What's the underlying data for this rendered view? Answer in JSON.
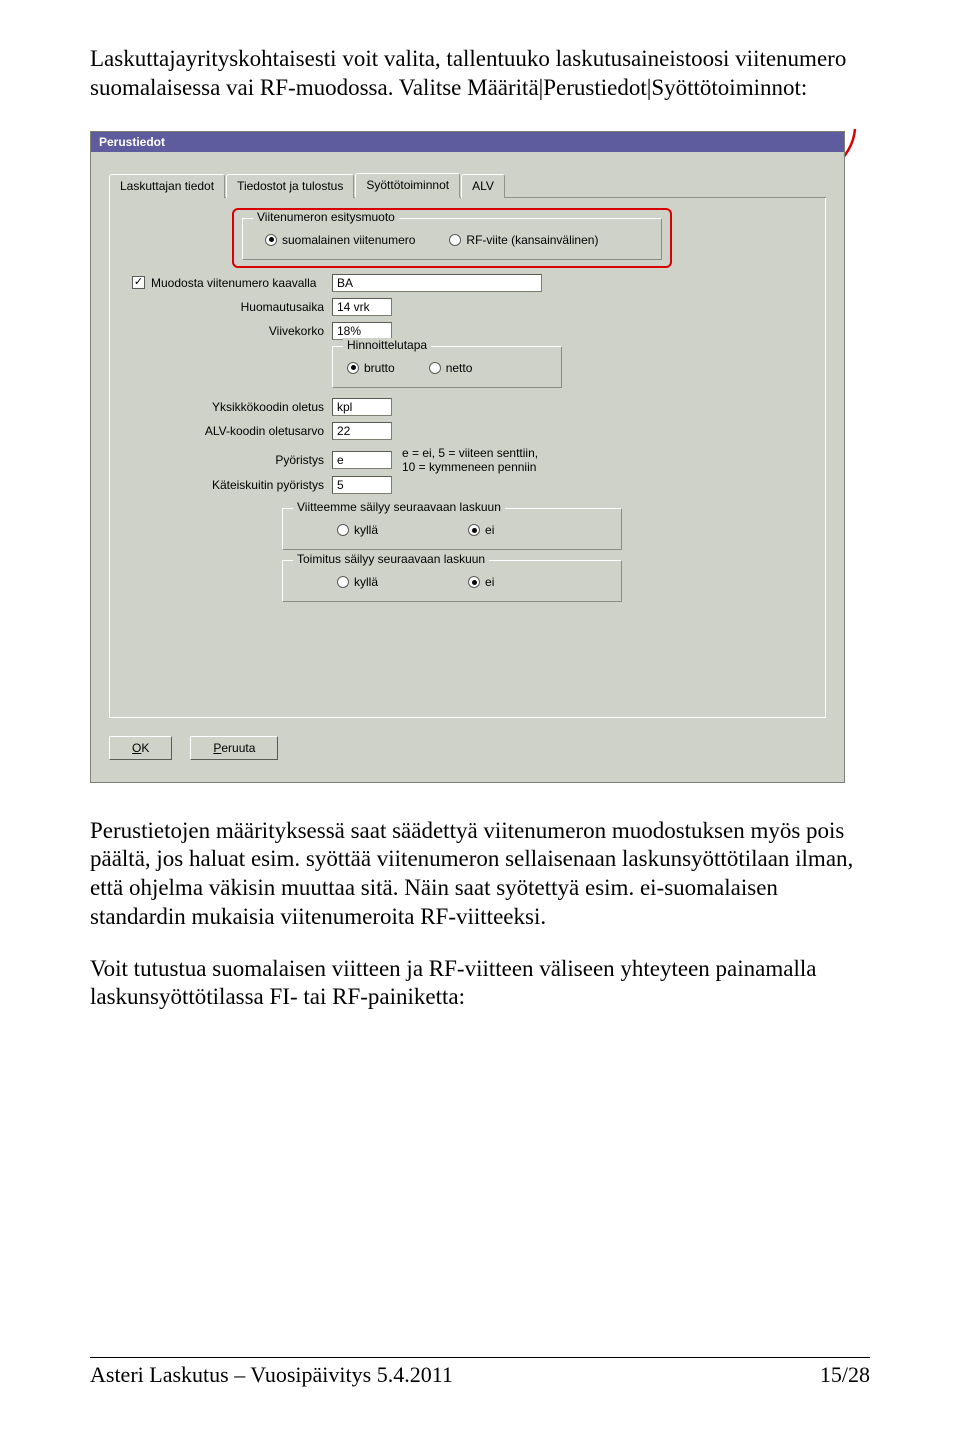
{
  "intro": {
    "p1": "Laskuttajayrityskohtaisesti voit valita, tallentuuko laskutusaineistoosi viitenumero suomalaisessa vai RF-muodossa. Valitse Määritä|Perustiedot|Syöttötoiminnot:"
  },
  "dialog": {
    "title": "Perustiedot",
    "tabs": {
      "t1": "Laskuttajan tiedot",
      "t2": "Tiedostot ja tulostus",
      "t3": "Syöttötoiminnot",
      "t4": "ALV"
    },
    "group_viite": {
      "legend": "Viitenumeron esitysmuoto",
      "opt1": "suomalainen viitenumero",
      "opt2": "RF-viite (kansainvälinen)"
    },
    "checkbox_label": "Muodosta viitenumero kaavalla",
    "ba_value": "BA",
    "row_huomautus": {
      "label": "Huomautusaika",
      "value": "14 vrk"
    },
    "row_viivekorko": {
      "label": "Viivekorko",
      "value": "18%"
    },
    "group_hinnoittelu": {
      "legend": "Hinnoittelutapa",
      "opt1": "brutto",
      "opt2": "netto"
    },
    "row_yksikko": {
      "label": "Yksikkökoodin oletus",
      "value": "kpl"
    },
    "row_alv": {
      "label": "ALV-koodin oletusarvo",
      "value": "22"
    },
    "row_pyoristys": {
      "label": "Pyöristys",
      "value": "e"
    },
    "row_kateis": {
      "label": "Käteiskuitin pyöristys",
      "value": "5"
    },
    "pyoristys_hint1": "e = ei, 5 = viiteen senttiin,",
    "pyoristys_hint2": "10 = kymmeneen penniin",
    "group_viitteemme": {
      "legend": "Viitteemme säilyy seuraavaan laskuun",
      "opt1": "kyllä",
      "opt2": "ei"
    },
    "group_toimitus": {
      "legend": "Toimitus säilyy seuraavaan laskuun",
      "opt1": "kyllä",
      "opt2": "ei"
    },
    "btn_ok_u": "O",
    "btn_ok_rest": "K",
    "btn_cancel_u": "P",
    "btn_cancel_rest": "eruuta"
  },
  "after": {
    "p1": "Perustietojen määrityksessä saat säädettyä viitenumeron muodostuksen myös pois päältä, jos haluat esim. syöttää viitenumeron sellaisenaan laskunsyöttötilaan ilman, että ohjelma väkisin muuttaa sitä. Näin saat syötettyä esim. ei-suomalaisen standardin mukaisia viitenumeroita RF-viitteeksi.",
    "p2": "Voit tutustua suomalaisen viitteen ja RF-viitteen väliseen yhteyteen painamalla laskunsyöttötilassa FI- tai RF-painiketta:"
  },
  "footer": {
    "left": "Asteri Laskutus – Vuosipäivitys 5.4.2011",
    "right": "15/28"
  }
}
